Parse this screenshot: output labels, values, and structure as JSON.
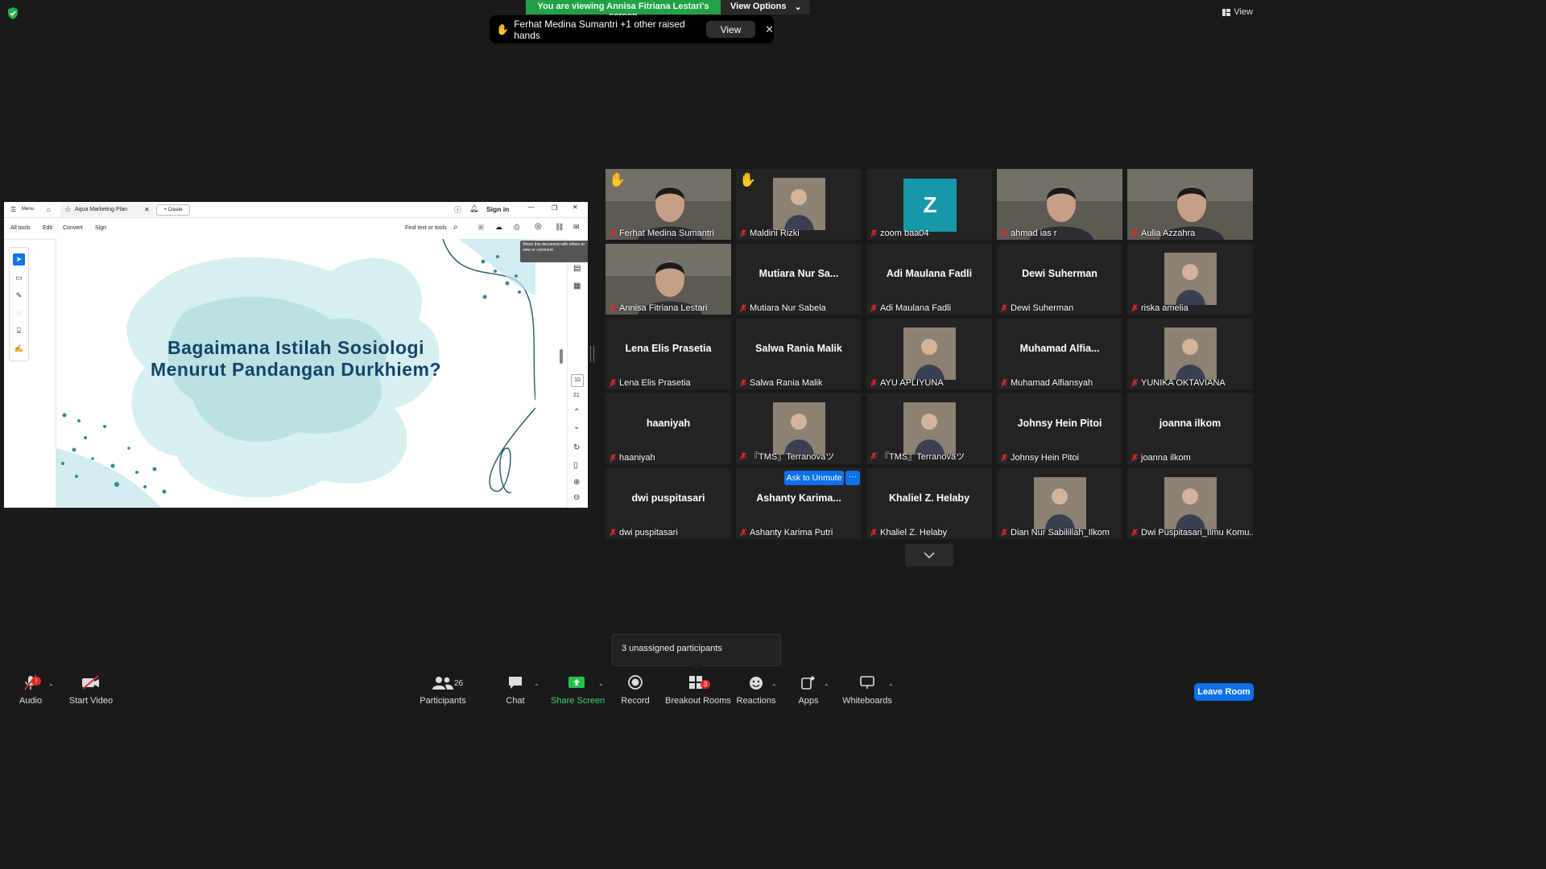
{
  "top": {
    "viewing_text": "You are viewing Annisa Fitriana Lestari's screen",
    "view_options_label": "View Options",
    "view_label": "View"
  },
  "raise_banner": {
    "text": "Ferhat Medina Sumantri +1 other raised hands",
    "view_button": "View",
    "close": "✕"
  },
  "shared_screen": {
    "menu_label": "Menu",
    "tab_title": "Aqua Marketing Plan",
    "create_label": "Create",
    "sign_in_label": "Sign in",
    "menu_items": [
      "All tools",
      "Edit",
      "Convert",
      "Sign"
    ],
    "find_placeholder": "Find text or tools",
    "tooltip": "Share this document with others to view or comment",
    "slide_title_line1": "Bagaimana Istilah Sosiologi",
    "slide_title_line2": "Menurut Pandangan Durkhiem?",
    "page_current": "10",
    "page_total": "21"
  },
  "participants_grid": [
    {
      "name": "Ferhat Medina Sumantri",
      "big": "",
      "hand": true,
      "video": true
    },
    {
      "name": "Maldini Rizki",
      "big": "",
      "hand": true,
      "photo": true
    },
    {
      "name": "zoom baa04",
      "big": "",
      "avatar_letter": "Z"
    },
    {
      "name": "ahmad ias r",
      "big": "",
      "video": true
    },
    {
      "name": "Aulia Azzahra",
      "big": "",
      "video": true
    },
    {
      "name": "Annisa Fitriana Lestari",
      "big": "",
      "video": true,
      "active": true
    },
    {
      "name": "Mutiara Nur Sabela",
      "big": "Mutiara  Nur  Sa..."
    },
    {
      "name": "Adi Maulana Fadli",
      "big": "Adi Maulana Fadli"
    },
    {
      "name": "Dewi Suherman",
      "big": "Dewi Suherman"
    },
    {
      "name": "riska amelia",
      "big": "",
      "photo": true
    },
    {
      "name": "Lena Elis Prasetia",
      "big": "Lena Elis Prasetia"
    },
    {
      "name": "Salwa Rania Malik",
      "big": "Salwa Rania Malik"
    },
    {
      "name": "AYU APLIYUNA",
      "big": "",
      "photo": true
    },
    {
      "name": "Muhamad Alfiansyah",
      "big": "Muhamad  Alfia..."
    },
    {
      "name": "YUNIKA OKTAVIANA",
      "big": "",
      "photo": true
    },
    {
      "name": "haaniyah",
      "big": "haaniyah"
    },
    {
      "name": "『TMS』Terranovaツ",
      "big": "",
      "photo": true
    },
    {
      "name": "『TMS』Terranovaツ",
      "big": "",
      "photo": true
    },
    {
      "name": "Johnsy Hein Pitoi",
      "big": "Johnsy Hein Pitoi"
    },
    {
      "name": "joanna ilkom",
      "big": "joanna ilkom"
    },
    {
      "name": "dwi puspitasari",
      "big": "dwi puspitasari"
    },
    {
      "name": "Ashanty Karima Putri",
      "big": "Ashanty  Karima..."
    },
    {
      "name": "Khaliel Z. Helaby",
      "big": "Khaliel Z. Helaby"
    },
    {
      "name": "Dian Nur Sabilillah_Ilkom",
      "big": "",
      "photo": true
    },
    {
      "name": "Dwi Puspitasari_Ilmu Komu...",
      "big": "",
      "photo": true
    }
  ],
  "ask_to_unmute": "Ask to Unmute",
  "ask_more": "···",
  "unassigned_text": "3 unassigned participants",
  "toolbar": {
    "audio": "Audio",
    "audio_badge": "!",
    "start_video": "Start Video",
    "participants": "Participants",
    "participants_count": "26",
    "chat": "Chat",
    "share_screen": "Share Screen",
    "record": "Record",
    "breakout_rooms": "Breakout Rooms",
    "breakout_badge": "3",
    "reactions": "Reactions",
    "apps": "Apps",
    "whiteboards": "Whiteboards",
    "leave_room": "Leave Room"
  },
  "colors": {
    "zoom_blue": "#0e71eb",
    "green": "#24a148",
    "active_speaker": "#f1e05a",
    "slide_title": "#14436b",
    "avatar_teal": "#1598a8",
    "mute_red": "#e02828"
  }
}
